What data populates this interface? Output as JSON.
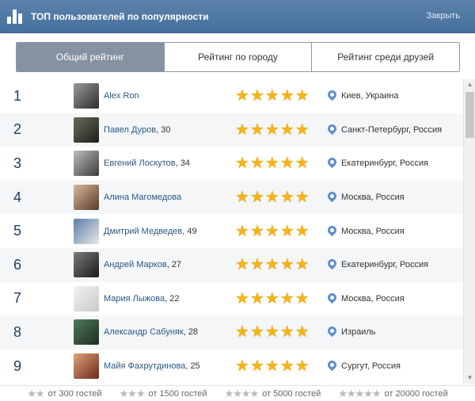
{
  "header": {
    "title": "ТОП пользователей по популярности",
    "close_label": "Закрыть"
  },
  "tabs": [
    {
      "label": "Общий рейтинг",
      "active": true
    },
    {
      "label": "Рейтинг по городу",
      "active": false
    },
    {
      "label": "Рейтинг среди друзей",
      "active": false
    }
  ],
  "users": [
    {
      "rank": "1",
      "name": "Alex Ron",
      "age": "",
      "stars": 5,
      "city": "Киев, Украина"
    },
    {
      "rank": "2",
      "name": "Павел Дуров",
      "age": "30",
      "stars": 5,
      "city": "Санкт-Петербург, Россия"
    },
    {
      "rank": "3",
      "name": "Евгений Лоскутов",
      "age": "34",
      "stars": 5,
      "city": "Екатеринбург, Россия"
    },
    {
      "rank": "4",
      "name": "Алина Магомедова",
      "age": "",
      "stars": 5,
      "city": "Москва, Россия"
    },
    {
      "rank": "5",
      "name": "Дмитрий Медведев",
      "age": "49",
      "stars": 5,
      "city": "Москва, Россия"
    },
    {
      "rank": "6",
      "name": "Андрей Марков",
      "age": "27",
      "stars": 5,
      "city": "Екатеринбург, Россия"
    },
    {
      "rank": "7",
      "name": "Мария Лыжова",
      "age": "22",
      "stars": 5,
      "city": "Москва, Россия"
    },
    {
      "rank": "8",
      "name": "Александр Сабуняк",
      "age": "28",
      "stars": 5,
      "city": "Израиль"
    },
    {
      "rank": "9",
      "name": "Майя Фахрутдинова",
      "age": "25",
      "stars": 5,
      "city": "Сургут, Россия"
    }
  ],
  "legend": [
    {
      "stars": 2,
      "label": "от 300 гостей"
    },
    {
      "stars": 3,
      "label": "от 1500 гостей"
    },
    {
      "stars": 4,
      "label": "от 5000 гостей"
    },
    {
      "stars": 5,
      "label": "от 20000 гостей"
    }
  ],
  "colors": {
    "header": "#4f77a2",
    "active_tab": "#8592a2",
    "star": "#f5b318",
    "link": "#2a5885"
  }
}
